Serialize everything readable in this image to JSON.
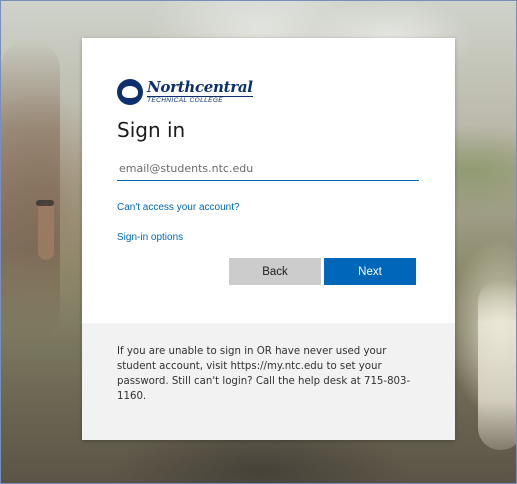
{
  "logo": {
    "name": "Northcentral",
    "subtitle": "TECHNICAL COLLEGE"
  },
  "signin": {
    "title": "Sign in",
    "email": {
      "placeholder": "email@students.ntc.edu",
      "value": ""
    },
    "cant_access_link": "Can't access your account?",
    "signin_options_link": "Sign-in options",
    "back_label": "Back",
    "next_label": "Next"
  },
  "footer": {
    "help_text": "If you are unable to sign in OR have never used your student account, visit https://my.ntc.edu to set your password. Still can't login? Call the help desk at 715-803-1160."
  },
  "colors": {
    "accent": "#0067b8",
    "brand": "#0d2f6e",
    "back_button": "#cccccc"
  },
  "icons": {
    "logo": "ntc-emblem-icon"
  }
}
